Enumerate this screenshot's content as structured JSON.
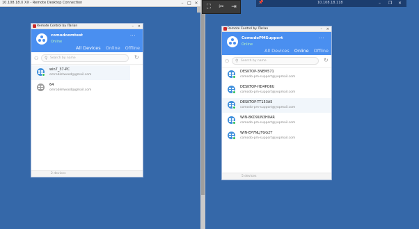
{
  "rdp": {
    "title": "10.108.18.X XX - Remote Desktop Connection"
  },
  "toolbar": {
    "items": [
      "pin-icon",
      "disconnect-icon",
      "exit-icon"
    ]
  },
  "remote_bar": {
    "ip": "10.108.18.118"
  },
  "left_window": {
    "title": "Remote Control by ITarian",
    "user": "comodoomtest",
    "status": "Online",
    "tabs": [
      "All Devices",
      "Online",
      "Offline"
    ],
    "active_tab": "All Devices",
    "search_placeholder": "Search by name",
    "devices": [
      {
        "name": "win7_37-PC",
        "email": "omrobletwood@gmail.com",
        "online": true,
        "selected": true
      },
      {
        "name": "64",
        "email": "omrobletwood@gmail.com",
        "online": false,
        "selected": false
      }
    ],
    "footer": "2 devices"
  },
  "right_window": {
    "title": "Remote Control by ITarian",
    "user": "ComodoPMSupport",
    "status": "Online",
    "tabs": [
      "All Devices",
      "Online",
      "Offline"
    ],
    "active_tab": "Online",
    "search_placeholder": "Search by name",
    "devices": [
      {
        "name": "DESKTOP-3NEM571",
        "email": "comodo-pm-support@yopmail.com",
        "online": true,
        "selected": false
      },
      {
        "name": "DESKTOP-HD4PO6U",
        "email": "comodo-pm-support@yopmail.com",
        "online": true,
        "selected": false
      },
      {
        "name": "DESKTOP-TT153A5",
        "email": "comodo-pm-support@yopmail.com",
        "online": true,
        "selected": true
      },
      {
        "name": "WIN-8KD9UN3H0AR",
        "email": "comodo-pm-support@yopmail.com",
        "online": true,
        "selected": false
      },
      {
        "name": "WIN-EP7NLJTGG2T",
        "email": "comodo-pm-support@yopmail.com",
        "online": true,
        "selected": false
      }
    ],
    "footer": "5 devices"
  },
  "colors": {
    "desktop": "#3568a9",
    "header_blue": "#4a8ff0",
    "online_icon": "#3f8fdc",
    "offline_icon": "#9e9e9e",
    "online_dot": "#2fbf5a"
  }
}
